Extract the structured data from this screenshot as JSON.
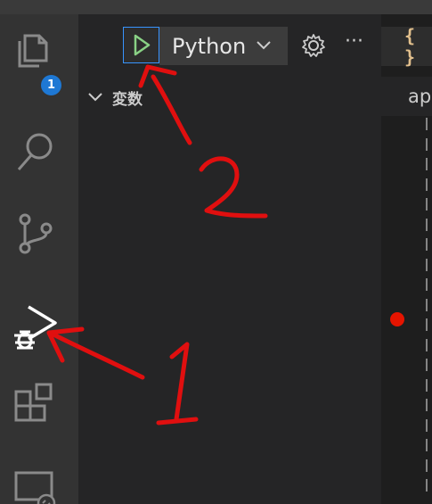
{
  "activity_bar": {
    "explorer_badge": "1",
    "items": [
      {
        "name": "explorer-icon"
      },
      {
        "name": "search-icon"
      },
      {
        "name": "source-control-icon"
      },
      {
        "name": "run-debug-icon"
      },
      {
        "name": "extensions-icon"
      },
      {
        "name": "remote-explorer-icon"
      }
    ]
  },
  "debug_toolbar": {
    "configuration": "Python",
    "run_icon": "play-icon",
    "settings_icon": "gear-icon",
    "more_label": "···"
  },
  "sidebar": {
    "section_title": "変数"
  },
  "editor": {
    "tab_icon_label": "{ }",
    "tab2_label": "ap"
  },
  "annotations": {
    "label_1": "1",
    "label_2": "2",
    "color": "#e00f0f"
  }
}
